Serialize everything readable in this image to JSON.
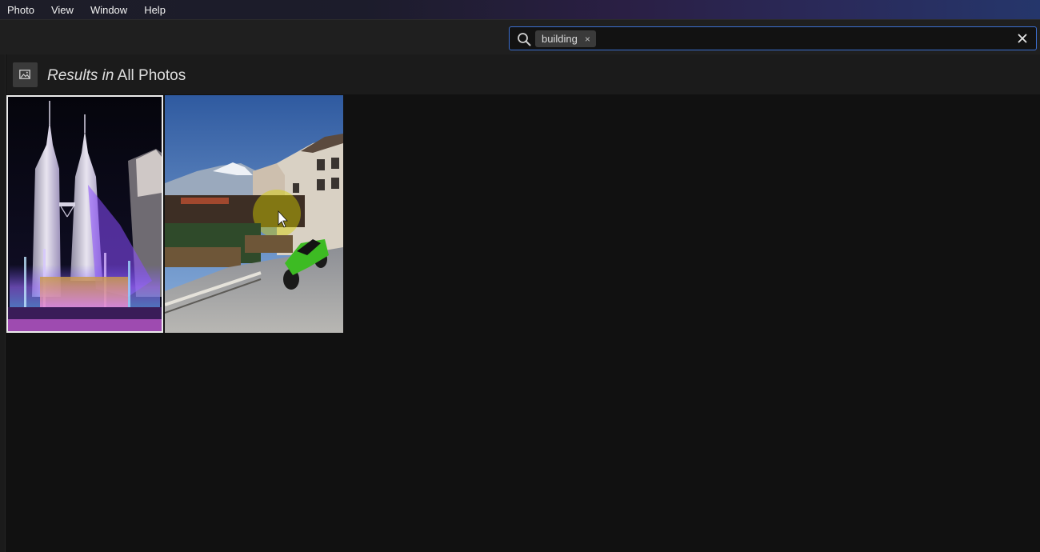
{
  "menu": {
    "items": [
      "Photo",
      "View",
      "Window",
      "Help"
    ]
  },
  "search": {
    "chip_label": "building",
    "chip_remove": "×",
    "icon": "search-icon",
    "clear_icon": "close-icon"
  },
  "results": {
    "prefix": "Results in",
    "scope": "All Photos",
    "icon": "image-icon"
  },
  "photos": [
    {
      "description_name": "petronas-towers-night",
      "selected": true
    },
    {
      "description_name": "motorcycle-mountain-village",
      "selected": false
    }
  ],
  "colors": {
    "accent": "#3b6fd0",
    "selection_border": "#ececec",
    "background": "#111111"
  }
}
